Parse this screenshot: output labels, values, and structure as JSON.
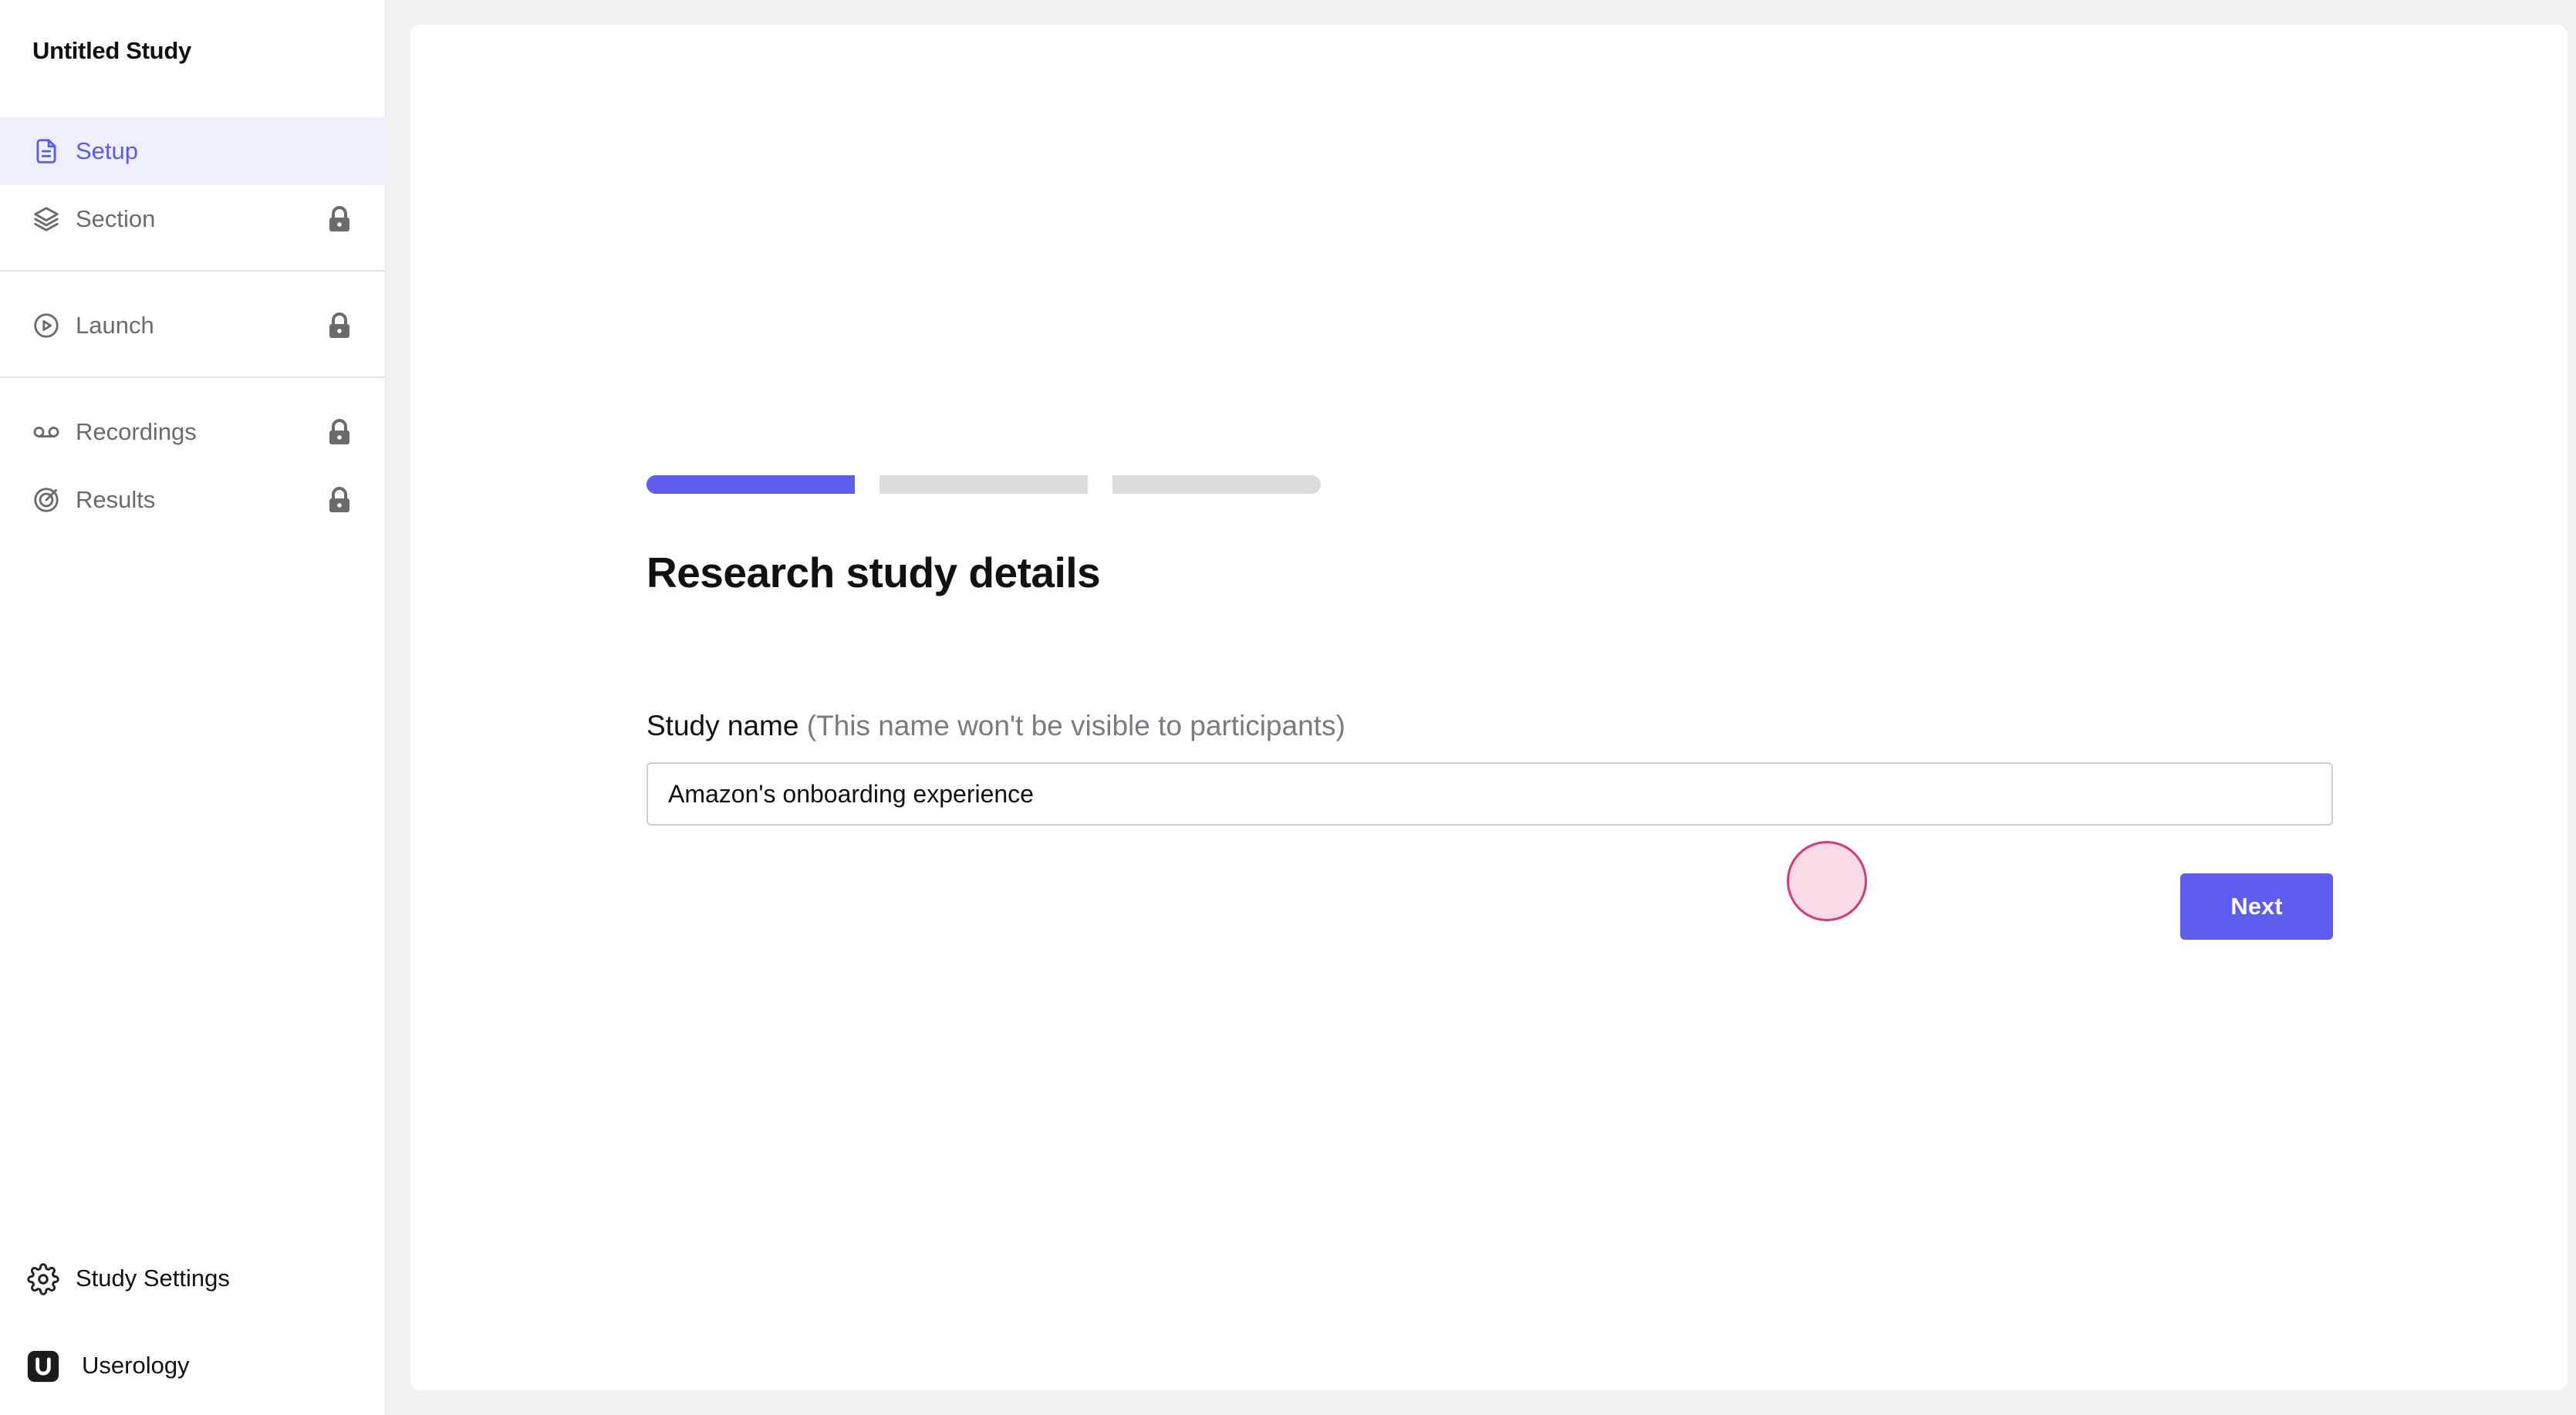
{
  "sidebar": {
    "study_title": "Untitled Study",
    "nav_items": [
      {
        "label": "Setup",
        "icon": "document-icon",
        "locked": false,
        "active": true
      },
      {
        "label": "Section",
        "icon": "layers-icon",
        "locked": true,
        "active": false
      },
      {
        "label": "Launch",
        "icon": "play-circle-icon",
        "locked": true,
        "active": false
      },
      {
        "label": "Recordings",
        "icon": "voicemail-icon",
        "locked": true,
        "active": false
      },
      {
        "label": "Results",
        "icon": "target-icon",
        "locked": true,
        "active": false
      }
    ],
    "settings_label": "Study Settings",
    "brand_label": "Userology"
  },
  "main": {
    "progress": {
      "current_step": 1,
      "total_steps": 3
    },
    "title": "Research study details",
    "field": {
      "label": "Study name",
      "hint": "(This name won't be visible to participants)",
      "value": "Amazon's onboarding experience"
    },
    "next_label": "Next"
  },
  "colors": {
    "accent": "#5f5cf0",
    "active_bg": "#eef0fd",
    "click_marker": "#d63a7a"
  }
}
